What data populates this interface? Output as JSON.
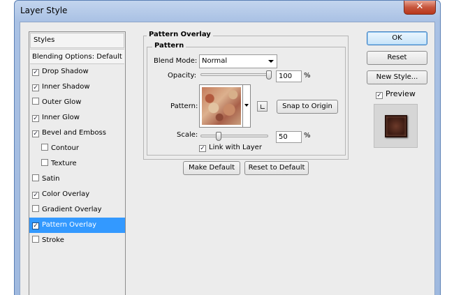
{
  "window": {
    "title": "Layer Style",
    "close_glyph": "✕"
  },
  "styles_list": {
    "header": "Styles",
    "blending_options": "Blending Options: Default",
    "items": [
      {
        "label": "Drop Shadow",
        "checked": true,
        "indent": false,
        "selected": false
      },
      {
        "label": "Inner Shadow",
        "checked": true,
        "indent": false,
        "selected": false
      },
      {
        "label": "Outer Glow",
        "checked": false,
        "indent": false,
        "selected": false
      },
      {
        "label": "Inner Glow",
        "checked": true,
        "indent": false,
        "selected": false
      },
      {
        "label": "Bevel and Emboss",
        "checked": true,
        "indent": false,
        "selected": false
      },
      {
        "label": "Contour",
        "checked": false,
        "indent": true,
        "selected": false
      },
      {
        "label": "Texture",
        "checked": false,
        "indent": true,
        "selected": false
      },
      {
        "label": "Satin",
        "checked": false,
        "indent": false,
        "selected": false
      },
      {
        "label": "Color Overlay",
        "checked": true,
        "indent": false,
        "selected": false
      },
      {
        "label": "Gradient Overlay",
        "checked": false,
        "indent": false,
        "selected": false
      },
      {
        "label": "Pattern Overlay",
        "checked": true,
        "indent": false,
        "selected": true
      },
      {
        "label": "Stroke",
        "checked": false,
        "indent": false,
        "selected": false
      }
    ]
  },
  "pattern_overlay": {
    "group_title": "Pattern Overlay",
    "subgroup_title": "Pattern",
    "blend_mode_label": "Blend Mode:",
    "blend_mode_value": "Normal",
    "opacity_label": "Opacity:",
    "opacity_value": "100",
    "opacity_unit": "%",
    "opacity_fraction": 1.0,
    "pattern_label": "Pattern:",
    "snap_button": "Snap to Origin",
    "scale_label": "Scale:",
    "scale_value": "50",
    "scale_unit": "%",
    "scale_fraction": 0.25,
    "link_label": "Link with Layer",
    "link_checked": true,
    "make_default_button": "Make Default",
    "reset_default_button": "Reset to Default"
  },
  "actions": {
    "ok": "OK",
    "reset": "Reset",
    "new_style": "New Style...",
    "preview_label": "Preview",
    "preview_checked": true
  },
  "icons": {
    "checkmark": "✓",
    "dropdown": "chevron-down-icon",
    "close": "close-icon",
    "new_pattern": "new-preset-icon"
  }
}
